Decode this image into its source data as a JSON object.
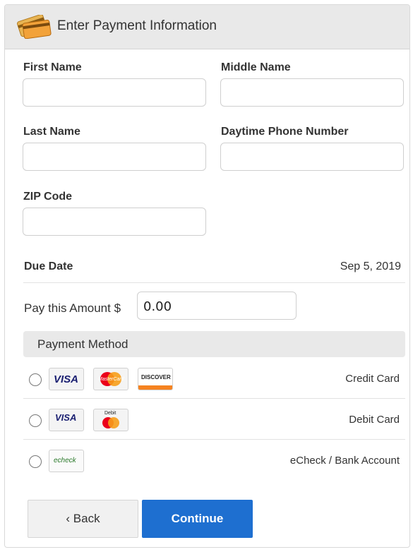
{
  "header": {
    "title": "Enter Payment Information",
    "icon": "credit-cards-icon"
  },
  "form": {
    "first_name": {
      "label": "First Name",
      "value": ""
    },
    "middle_name": {
      "label": "Middle Name",
      "value": ""
    },
    "last_name": {
      "label": "Last Name",
      "value": ""
    },
    "phone": {
      "label": "Daytime Phone Number",
      "value": ""
    },
    "zip": {
      "label": "ZIP Code",
      "value": ""
    }
  },
  "due": {
    "label": "Due Date",
    "value": "Sep 5, 2019"
  },
  "amount": {
    "label": "Pay this Amount $",
    "value": "0.00"
  },
  "payment_method": {
    "title": "Payment Method",
    "options": [
      {
        "label": "Credit Card",
        "cards": [
          "VISA",
          "MasterCard",
          "DISCOVER"
        ]
      },
      {
        "label": "Debit Card",
        "cards": [
          "VISA",
          "Debit"
        ]
      },
      {
        "label": "eCheck / Bank Account",
        "cards": [
          "echeck"
        ]
      }
    ]
  },
  "buttons": {
    "back": "‹ Back",
    "continue": "Continue"
  },
  "colors": {
    "primary": "#1e6fd0",
    "header_bg": "#e9e9e9",
    "border": "#cfcfcf"
  }
}
